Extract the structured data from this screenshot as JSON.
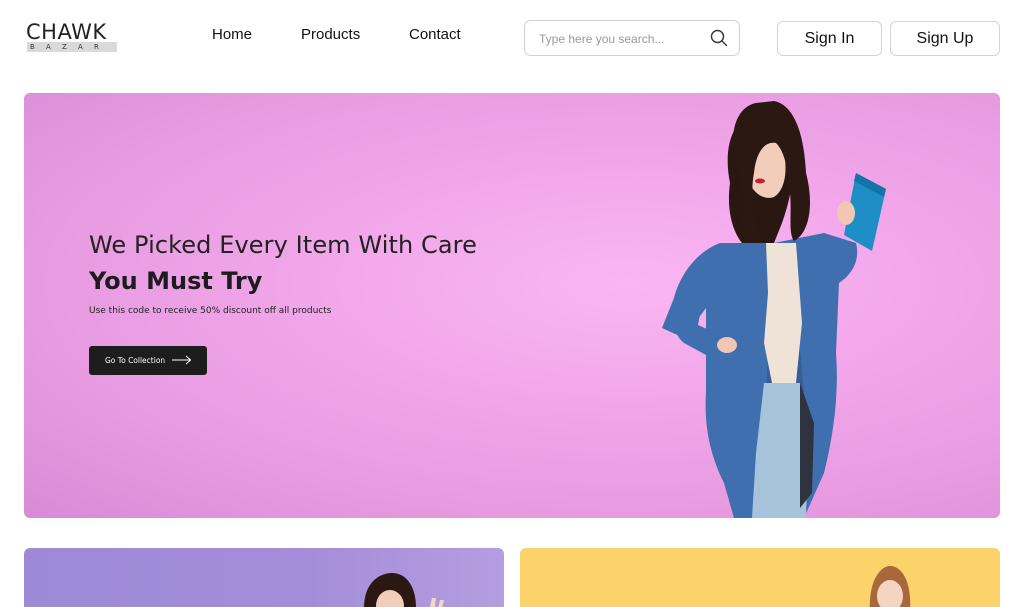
{
  "logo": {
    "main": "CHAWK",
    "sub": "BAZAR"
  },
  "nav": {
    "home": "Home",
    "products": "Products",
    "contact": "Contact"
  },
  "search": {
    "placeholder": "Type here you search..."
  },
  "auth": {
    "sign_in": "Sign In",
    "sign_up": "Sign Up"
  },
  "hero": {
    "tagline": "We Picked Every Item With Care",
    "title": "You Must Try",
    "description": "Use this code to receive 50% discount off all products",
    "cta": "Go To Collection"
  },
  "colors": {
    "hero_bg": "#f2a7ea",
    "cta_bg": "#1d1d1d",
    "card_purple": "#a58ed9",
    "card_yellow": "#fcd26b"
  },
  "icons": {
    "search": "search-icon",
    "arrow": "arrow-right-icon"
  }
}
